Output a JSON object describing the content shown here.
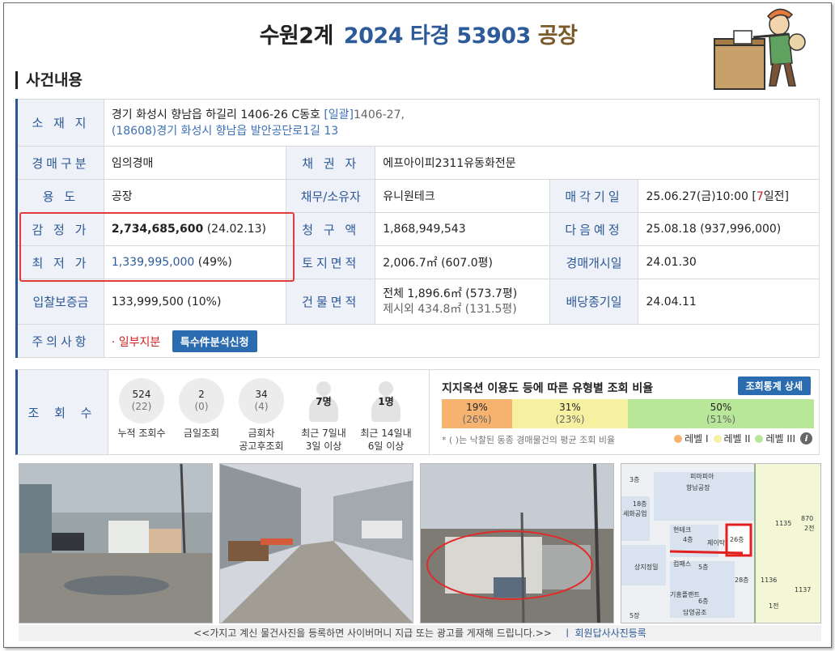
{
  "header": {
    "court": "수원2계",
    "case_year": "2024 타경 53903",
    "case_number": "",
    "category": "공장"
  },
  "section_title": "사건내용",
  "info": {
    "location_label": "소 재 지",
    "location_line1": "경기 화성시 향남읍 하길리 1406-26 C동호",
    "location_bulk": "[일괄]",
    "location_bulk_value": "1406-27,",
    "location_line2": "(18608)경기 화성시  향남읍 발안공단로1길  13",
    "auction_type_label": "경매구분",
    "auction_type": "임의경매",
    "creditor_label": "채 권 자",
    "creditor": "에프아이피2311유동화전문",
    "use_label": "용     도",
    "use": "공장",
    "debtor_label": "채무/소유자",
    "debtor": "유니원테크",
    "sale_date_label": "매각기일",
    "sale_date": "25.06.27(금)10:00 [",
    "sale_date_days": "7",
    "sale_date_suffix": "일전]",
    "appraisal_label": "감 정 가",
    "appraisal_value": "2,734,685,600",
    "appraisal_date": "(24.02.13)",
    "claim_label": "청 구 액",
    "claim": "1,868,949,543",
    "next_label": "다음예정",
    "next": "25.08.18 (937,996,000)",
    "min_label": "최 저 가",
    "min_value": "1,339,995,000",
    "min_pct": "(49%)",
    "land_label": "토지면적",
    "land": "2,006.7㎡ (607.0평)",
    "start_label": "경매개시일",
    "start": "24.01.30",
    "deposit_label": "입찰보증금",
    "deposit": "133,999,500 (10%)",
    "building_label": "건물면적",
    "building_total": "전체 1,896.6㎡ (573.7평)",
    "building_excl": "제시외 434.8㎡ (131.5평)",
    "dividend_label": "배당종기일",
    "dividend": "24.04.11",
    "notice_label": "주의사항",
    "notice": "· 일부지분",
    "notice_button": "특수件분석신청"
  },
  "stats": {
    "label": "조 회 수",
    "items": [
      {
        "n": "524",
        "s": "(22)",
        "cap1": "누적 조회수",
        "cap2": ""
      },
      {
        "n": "2",
        "s": "(0)",
        "cap1": "금일조회",
        "cap2": ""
      },
      {
        "n": "34",
        "s": "(4)",
        "cap1": "금회차",
        "cap2": "공고후조회"
      }
    ],
    "people": [
      {
        "n": "7명",
        "cap1": "최근 7일내",
        "cap2": "3일 이상"
      },
      {
        "n": "1명",
        "cap1": "최근 14일내",
        "cap2": "6일 이상"
      }
    ],
    "ratio_title": "지지옥션 이용도 등에 따른 유형별 조회 비율",
    "ratio_button": "조회통계 상세",
    "segments": [
      {
        "pct": "19%",
        "avg": "(26%)",
        "color": "#f5b36f",
        "frac": 0.19
      },
      {
        "pct": "31%",
        "avg": "(23%)",
        "color": "#f6f0a1",
        "frac": 0.31
      },
      {
        "pct": "50%",
        "avg": "(51%)",
        "color": "#b9e79a",
        "frac": 0.5
      }
    ],
    "note": "* ( )는 낙찰된 동종 경매물건의 평균 조회 비율",
    "legend": [
      "레벨 I",
      "레벨 II",
      "레벨 III"
    ],
    "info_icon": "i"
  },
  "map_labels": [
    "3층",
    "피마피아",
    "향남공장",
    "18층",
    "세화공업",
    "현테크",
    "4층",
    "제이탁",
    "26층",
    "상지정밀",
    "컴패스",
    "5층",
    "기흥플랜트",
    "6층",
    "담영공조",
    "1135",
    "870",
    "2전",
    "1136",
    "1137",
    "1전",
    "28층",
    "5장"
  ],
  "footer": {
    "text": "<<가지고 계신 물건사진을 등록하면 사이버머니 지급 또는 광고를 게재해 드립니다.>>",
    "link": "ㅣ 회원답사사진등록"
  }
}
